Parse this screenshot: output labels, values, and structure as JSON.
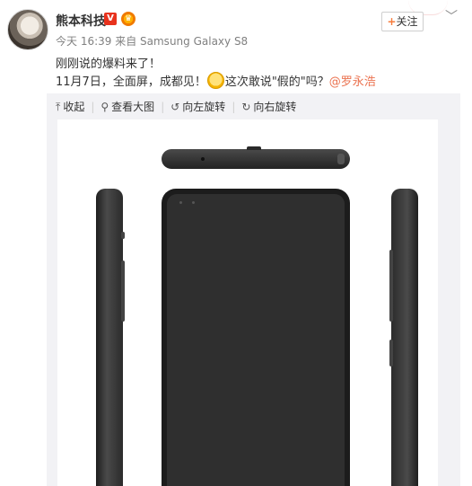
{
  "post": {
    "author": "熊本科技",
    "verified_badge": "V",
    "meta": "今天 16:39 来自 Samsung Galaxy S8",
    "text_line1": "刚刚说的爆料来了！",
    "text_line2_before_emoji": "11月7日，全面屏，成都见！",
    "text_line2_after_emoji": "这次敢说\"假的\"吗？",
    "mention": "@罗永浩",
    "follow_plus": "+",
    "follow_label": "关注",
    "more_icon": "chevron-down-icon"
  },
  "image_toolbar": {
    "collapse_label": "收起",
    "view_large_label": "查看大图",
    "rotate_left_label": "向左旋转",
    "rotate_right_label": "向右旋转"
  },
  "colors": {
    "mention": "#eb7350",
    "follow_plus": "#f77c3d",
    "verified_badge": "#e8321d",
    "panel_background": "#f2f2f5"
  }
}
